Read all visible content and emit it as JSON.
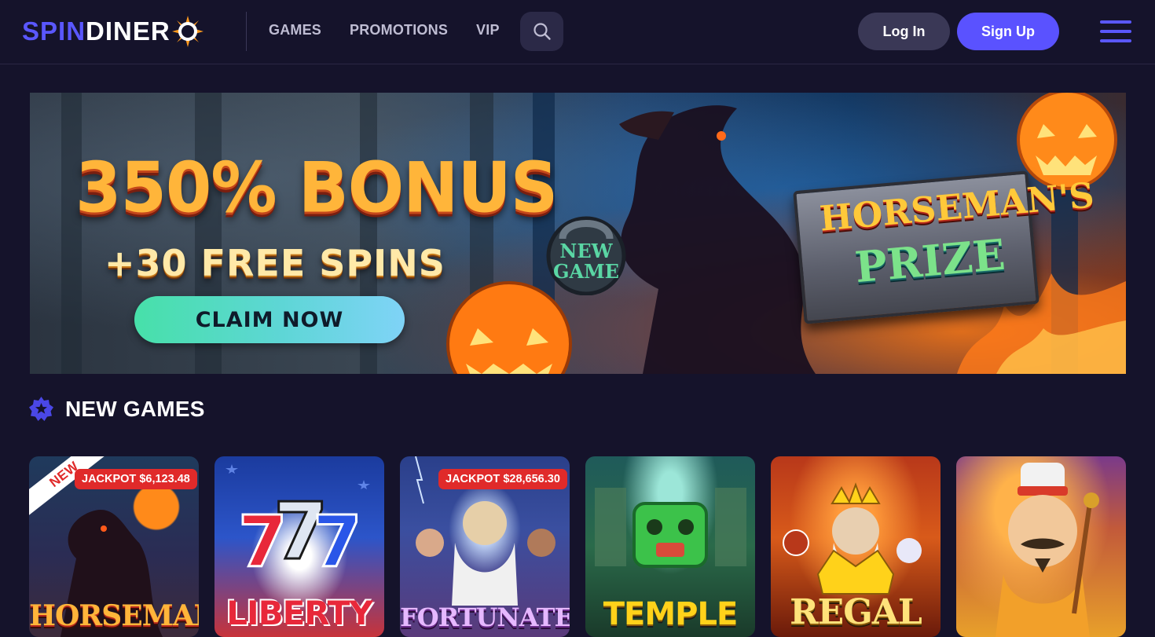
{
  "header": {
    "logo": {
      "part1": "SPIN",
      "part2": "DINER",
      "sun_icon": "sun-o-icon"
    },
    "nav": [
      {
        "label": "GAMES"
      },
      {
        "label": "PROMOTIONS"
      },
      {
        "label": "VIP"
      }
    ],
    "search_icon": "search-icon",
    "login_label": "Log In",
    "signup_label": "Sign Up",
    "menu_icon": "hamburger-menu-icon",
    "colors": {
      "brand_blue": "#5a57ff",
      "bg": "#15132b",
      "signup_bg": "#5a52ff"
    }
  },
  "hero": {
    "headline": "350% BONUS",
    "subheadline": "+30 FREE SPINS",
    "cta_label": "CLAIM NOW",
    "badge_line1": "NEW",
    "badge_line2": "GAME",
    "sign_line1": "HORSEMAN'S",
    "sign_line2": "PRIZE"
  },
  "section": {
    "icon": "star-badge-icon",
    "title": "NEW GAMES"
  },
  "games": [
    {
      "title": "HORSEMAN'S",
      "jackpot": "JACKPOT $6,123.48",
      "ribbon": "NEW"
    },
    {
      "title": "LIBERTY"
    },
    {
      "title": "FORTUNATE",
      "jackpot": "JACKPOT $28,656.30"
    },
    {
      "title": "TEMPLE"
    },
    {
      "title": "REGAL"
    },
    {
      "title": ""
    }
  ]
}
